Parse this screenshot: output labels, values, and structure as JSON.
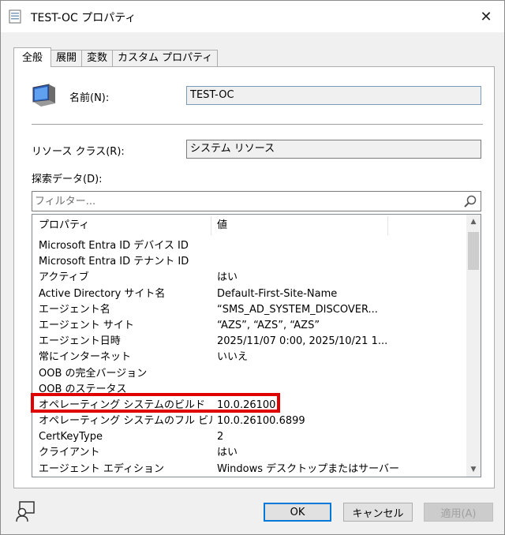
{
  "window": {
    "title": "TEST-OC プロパティ",
    "close_label": "✕"
  },
  "tabs": [
    {
      "label": "全般",
      "active": true
    },
    {
      "label": "展開",
      "active": false
    },
    {
      "label": "変数",
      "active": false
    },
    {
      "label": "カスタム プロパティ",
      "active": false
    }
  ],
  "general": {
    "name_label": "名前(N):",
    "name_value": "TEST-OC",
    "resource_class_label": "リソース クラス(R):",
    "resource_class_value": "システム リソース",
    "discovery_label": "探索データ(D):",
    "filter_placeholder": "フィルター..."
  },
  "grid": {
    "headers": [
      "プロパティ",
      "値"
    ],
    "rows": [
      {
        "k": "Microsoft Entra ID デバイス ID",
        "v": ""
      },
      {
        "k": "Microsoft Entra ID テナント ID",
        "v": ""
      },
      {
        "k": "アクティブ",
        "v": "はい"
      },
      {
        "k": "Active Directory サイト名",
        "v": "Default-First-Site-Name"
      },
      {
        "k": "エージェント名",
        "v": "“SMS_AD_SYSTEM_DISCOVER..."
      },
      {
        "k": "エージェント サイト",
        "v": "“AZS”, “AZS”, “AZS”"
      },
      {
        "k": "エージェント日時",
        "v": "2025/11/07 0:00, 2025/10/21 1..."
      },
      {
        "k": "常にインターネット",
        "v": "いいえ"
      },
      {
        "k": "OOB の完全バージョン",
        "v": ""
      },
      {
        "k": "OOB のステータス",
        "v": ""
      },
      {
        "k": "オペレーティング システムのビルド",
        "v": "10.0.26100"
      },
      {
        "k": "オペレーティング システムのフル ビル...",
        "v": "10.0.26100.6899"
      },
      {
        "k": "CertKeyType",
        "v": "2"
      },
      {
        "k": "クライアント",
        "v": "はい"
      },
      {
        "k": "エージェント エディション",
        "v": "Windows デスクトップまたはサーバー"
      }
    ]
  },
  "buttons": {
    "ok": "OK",
    "cancel": "キャンセル",
    "apply": "適用(A)"
  },
  "colors": {
    "highlight": "#e00000",
    "ok_border": "#0078d7"
  }
}
